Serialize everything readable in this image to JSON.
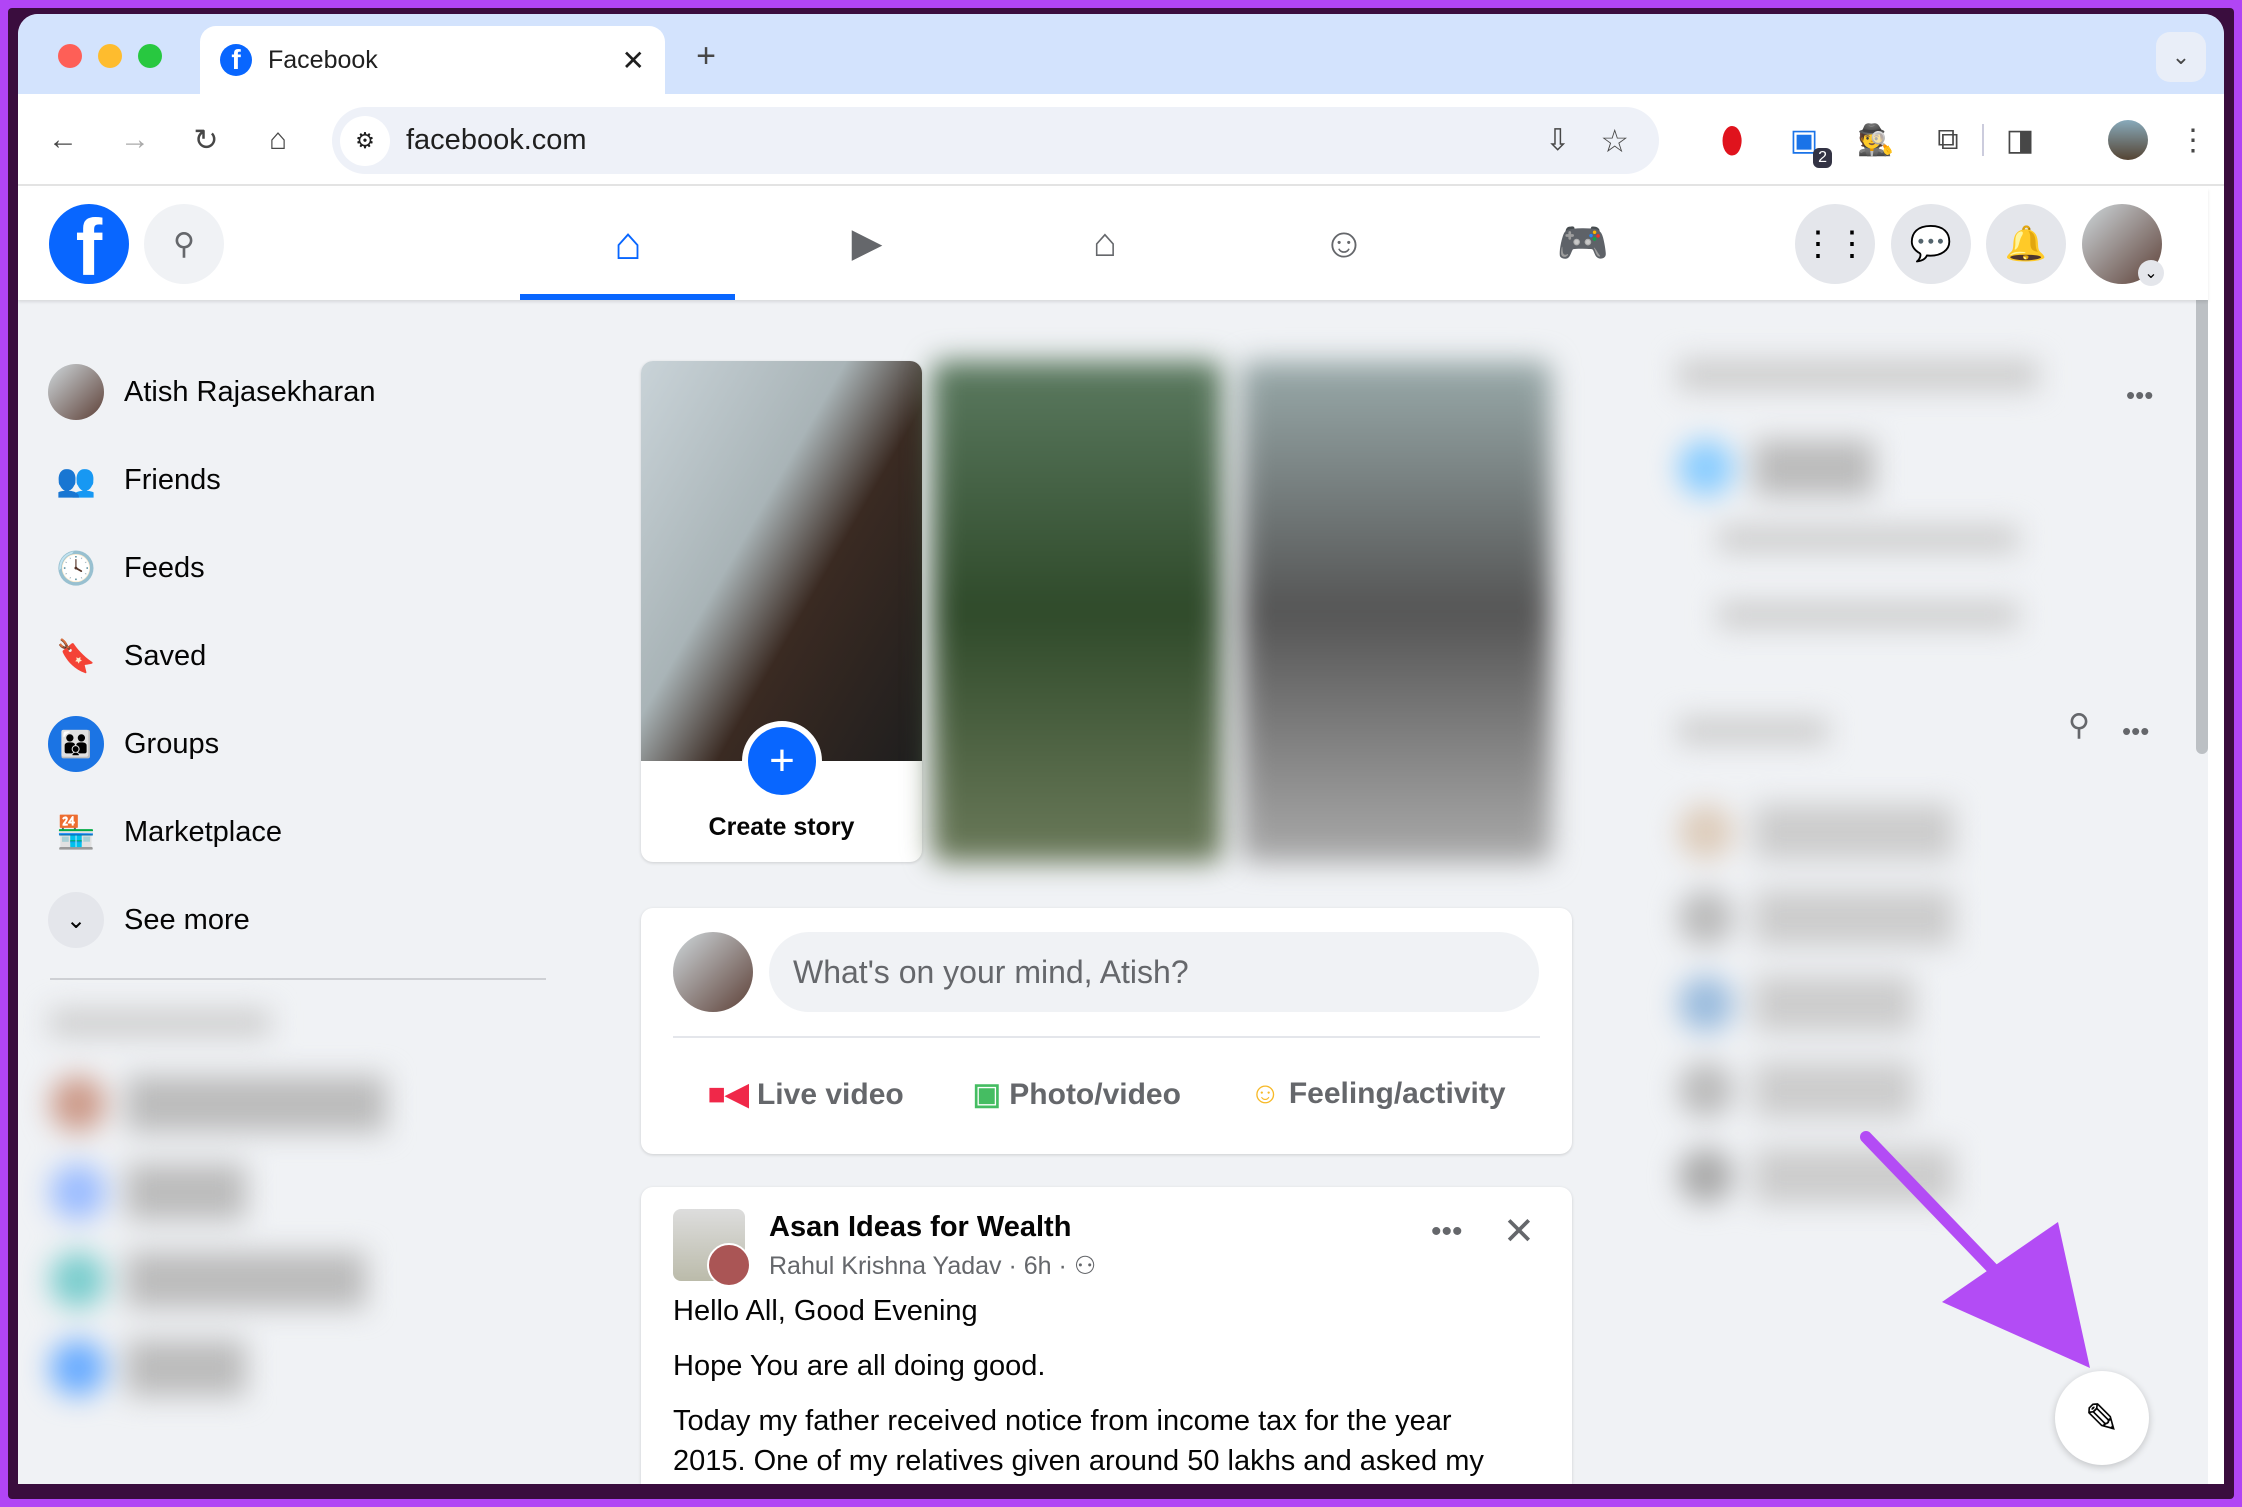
{
  "browser": {
    "tab_title": "Facebook",
    "url": "facebook.com",
    "extension_badge": "2"
  },
  "nav": {
    "tabs": [
      "home",
      "watch",
      "marketplace",
      "groups",
      "gaming"
    ],
    "active": "home"
  },
  "sidebar": {
    "items": [
      {
        "label": "Atish Rajasekharan",
        "icon": "avatar"
      },
      {
        "label": "Friends",
        "icon": "friends-icon"
      },
      {
        "label": "Feeds",
        "icon": "feeds-icon"
      },
      {
        "label": "Saved",
        "icon": "saved-icon"
      },
      {
        "label": "Groups",
        "icon": "groups-icon"
      },
      {
        "label": "Marketplace",
        "icon": "marketplace-icon"
      },
      {
        "label": "See more",
        "icon": "chevron-down-icon"
      }
    ]
  },
  "stories": {
    "create_label": "Create story"
  },
  "composer": {
    "placeholder": "What's on your mind, Atish?",
    "actions": [
      "Live video",
      "Photo/video",
      "Feeling/activity"
    ]
  },
  "post": {
    "page": "Asan Ideas for Wealth",
    "author": "Rahul Krishna Yadav",
    "time": "6h",
    "paragraphs": [
      "Hello All, Good Evening",
      "Hope You are all doing good.",
      "Today my father received notice from income tax for the year 2015. One of my relatives given around 50 lakhs and asked my"
    ]
  },
  "colors": {
    "brand": "#0866ff",
    "frame": "#b145f5",
    "arrow": "#b34cf5"
  }
}
